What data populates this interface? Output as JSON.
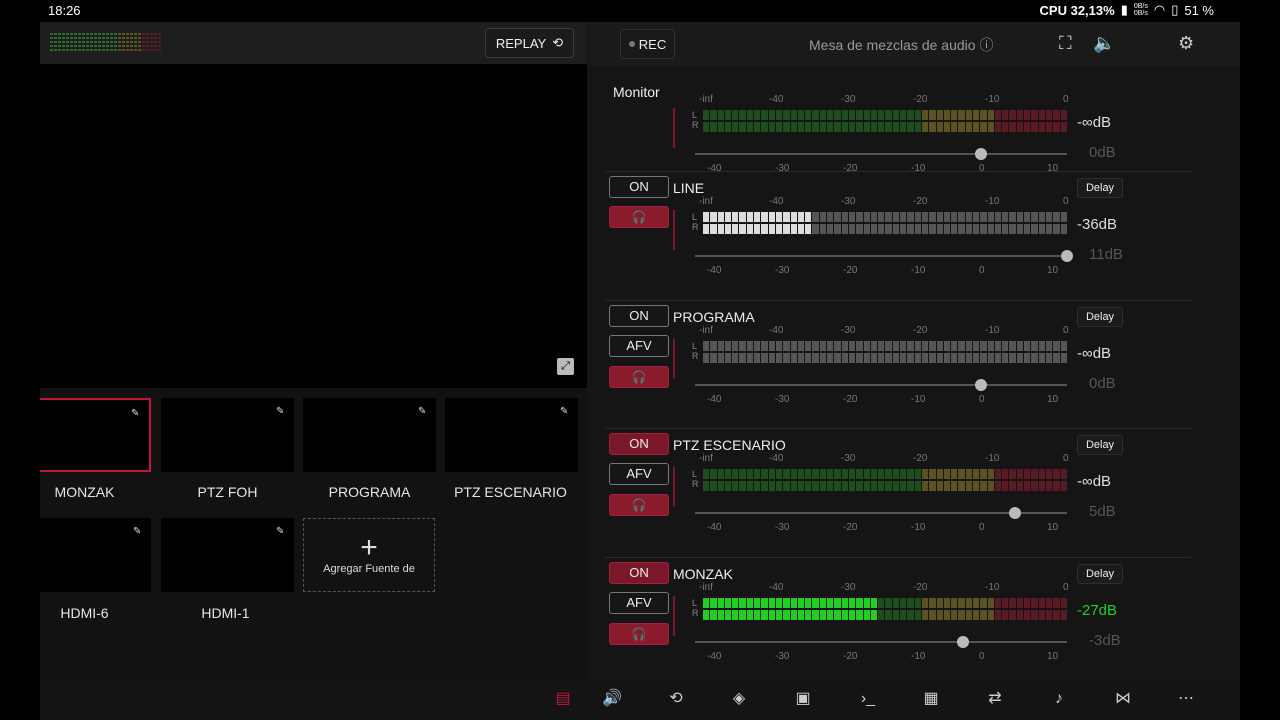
{
  "status": {
    "time": "18:26",
    "cpu": "CPU 32,13%",
    "net_up": "0B/s",
    "net_down": "0B/s",
    "battery": "51 %"
  },
  "left": {
    "replay_label": "REPLAY",
    "tiles": [
      {
        "label": "MONZAK",
        "active": true
      },
      {
        "label": "PTZ FOH"
      },
      {
        "label": "PROGRAMA"
      },
      {
        "label": "PTZ ESCENARIO"
      },
      {
        "label": "HDMI-6"
      },
      {
        "label": "HDMI-1"
      }
    ],
    "add_source_label": "Agregar Fuente de"
  },
  "mixer": {
    "rec_label": "REC",
    "title": "Mesa de mezclas de audio",
    "scale_top": [
      "-inf",
      "-40",
      "-30",
      "-20",
      "-10",
      "0"
    ],
    "scale_bottom": [
      "-40",
      "-30",
      "-20",
      "-10",
      "0",
      "10"
    ],
    "channels": [
      {
        "name": "Monitor",
        "level_db": "-∞dB",
        "gain_db": "0dB",
        "on": null,
        "afv": null,
        "headphone": false,
        "delay": null,
        "fader": 0.77,
        "meter": "green-dim",
        "meter_fill": 0
      },
      {
        "name": "LINE",
        "on_label": "ON",
        "on": false,
        "afv": null,
        "headphone": true,
        "delay": "Delay",
        "level_db": "-36dB",
        "gain_db": "11dB",
        "fader": 1.0,
        "meter": "gray",
        "meter_fill": 0.3
      },
      {
        "name": "PROGRAMA",
        "on_label": "ON",
        "on": false,
        "afv": "AFV",
        "headphone": true,
        "delay": "Delay",
        "level_db": "-∞dB",
        "gain_db": "0dB",
        "fader": 0.77,
        "meter": "gray",
        "meter_fill": 0
      },
      {
        "name": "PTZ ESCENARIO",
        "on_label": "ON",
        "on": true,
        "afv": "AFV",
        "headphone": true,
        "delay": "Delay",
        "level_db": "-∞dB",
        "gain_db": "5dB",
        "fader": 0.86,
        "meter": "green-dim",
        "meter_fill": 0
      },
      {
        "name": "MONZAK",
        "on_label": "ON",
        "on": true,
        "afv": "AFV",
        "headphone": true,
        "delay": "Delay",
        "level_db": "-27dB",
        "gain_db": "-3dB",
        "fader": 0.72,
        "meter": "green-dim",
        "meter_fill": 0.48
      }
    ]
  },
  "colors": {
    "accent": "#c4143a",
    "meter_green": "#1fd21f",
    "meter_dim_green": "#1e4d1e"
  },
  "bottom_icons": [
    "layout-icon",
    "audio-mixer-icon",
    "replay-icon",
    "layers-icon",
    "rec-icon",
    "terminal-icon",
    "calendar-icon",
    "switch-camera-icon",
    "music-file-icon",
    "transition-icon",
    "more-icon"
  ]
}
